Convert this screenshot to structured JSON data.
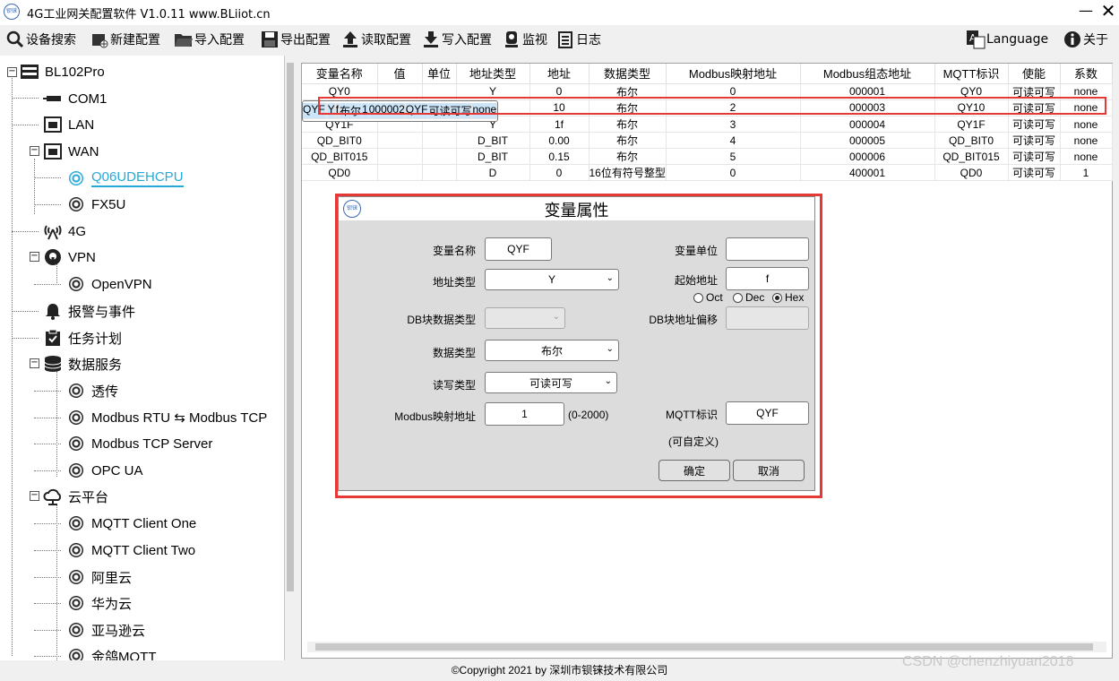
{
  "app": {
    "title": "4G工业网关配置软件 V1.0.11 www.BLiiot.cn",
    "logo_text": "钡铼",
    "min_icon": "—",
    "close_icon": "✕"
  },
  "toolbar": {
    "search": "设备搜索",
    "new": "新建配置",
    "import": "导入配置",
    "export": "导出配置",
    "read": "读取配置",
    "write": "写入配置",
    "monitor": "监视",
    "log": "日志",
    "language": "Language",
    "about": "关于"
  },
  "tree": {
    "root": "BL102Pro",
    "com1": "COM1",
    "lan": "LAN",
    "wan": "WAN",
    "q06": "Q06UDEHCPU",
    "fx5u": "FX5U",
    "g4": "4G",
    "vpn": "VPN",
    "openvpn": "OpenVPN",
    "alarm": "报警与事件",
    "task": "任务计划",
    "data_service": "数据服务",
    "passthrough": "透传",
    "modbus_rtu_tcp": "Modbus RTU ⇆ Modbus TCP",
    "modbus_tcp_server": "Modbus TCP Server",
    "opc_ua": "OPC UA",
    "cloud": "云平台",
    "mqtt_one": "MQTT Client One",
    "mqtt_two": "MQTT Client Two",
    "aliyun": "阿里云",
    "huawei": "华为云",
    "amazon": "亚马逊云",
    "jinge": "金鸽MQTT"
  },
  "table": {
    "headers": [
      "变量名称",
      "值",
      "单位",
      "地址类型",
      "地址",
      "数据类型",
      "Modbus映射地址",
      "Modbus组态地址",
      "MQTT标识",
      "使能",
      "系数"
    ],
    "rows": [
      [
        "QY0",
        "",
        "",
        "Y",
        "0",
        "布尔",
        "0",
        "000001",
        "QY0",
        "可读可写",
        "none"
      ],
      [
        "QYF",
        "",
        "",
        "Y",
        "f",
        "布尔",
        "1",
        "000002",
        "QYF",
        "可读可写",
        "none"
      ],
      [
        "QY10",
        "",
        "",
        "Y",
        "10",
        "布尔",
        "2",
        "000003",
        "QY10",
        "可读可写",
        "none"
      ],
      [
        "QY1F",
        "",
        "",
        "Y",
        "1f",
        "布尔",
        "3",
        "000004",
        "QY1F",
        "可读可写",
        "none"
      ],
      [
        "QD_BIT0",
        "",
        "",
        "D_BIT",
        "0.00",
        "布尔",
        "4",
        "000005",
        "QD_BIT0",
        "可读可写",
        "none"
      ],
      [
        "QD_BIT015",
        "",
        "",
        "D_BIT",
        "0.15",
        "布尔",
        "5",
        "000006",
        "QD_BIT015",
        "可读可写",
        "none"
      ],
      [
        "QD0",
        "",
        "",
        "D",
        "0",
        "16位有符号整型",
        "0",
        "400001",
        "QD0",
        "可读可写",
        "1"
      ]
    ],
    "selected_row": 1
  },
  "dialog": {
    "logo_text": "钡铼",
    "title": "变量属性",
    "var_name_label": "变量名称",
    "var_name_value": "QYF",
    "unit_label": "变量单位",
    "unit_value": "",
    "addr_type_label": "地址类型",
    "addr_type_value": "Y",
    "start_addr_label": "起始地址",
    "start_addr_value": "f",
    "oct": "Oct",
    "dec": "Dec",
    "hex": "Hex",
    "radix_selected": "Hex",
    "db_type_label": "DB块数据类型",
    "db_type_value": "",
    "db_offset_label": "DB块地址偏移",
    "db_offset_value": "",
    "data_type_label": "数据类型",
    "data_type_value": "布尔",
    "rw_label": "读写类型",
    "rw_value": "可读可写",
    "modbus_label": "Modbus映射地址",
    "modbus_value": "1",
    "modbus_range": "(0-2000)",
    "mqtt_label": "MQTT标识",
    "mqtt_value": "QYF",
    "mqtt_hint": "(可自定义)",
    "ok": "确定",
    "cancel": "取消"
  },
  "footer": {
    "copyright": "©Copyright 2021 by 深圳市钡铼技术有限公司",
    "watermark": "CSDN @chenzhiyuan2018"
  },
  "colors": {
    "highlight_red": "#e53935",
    "selected_row": "#cce4f7",
    "link_active": "#27a9d8"
  }
}
